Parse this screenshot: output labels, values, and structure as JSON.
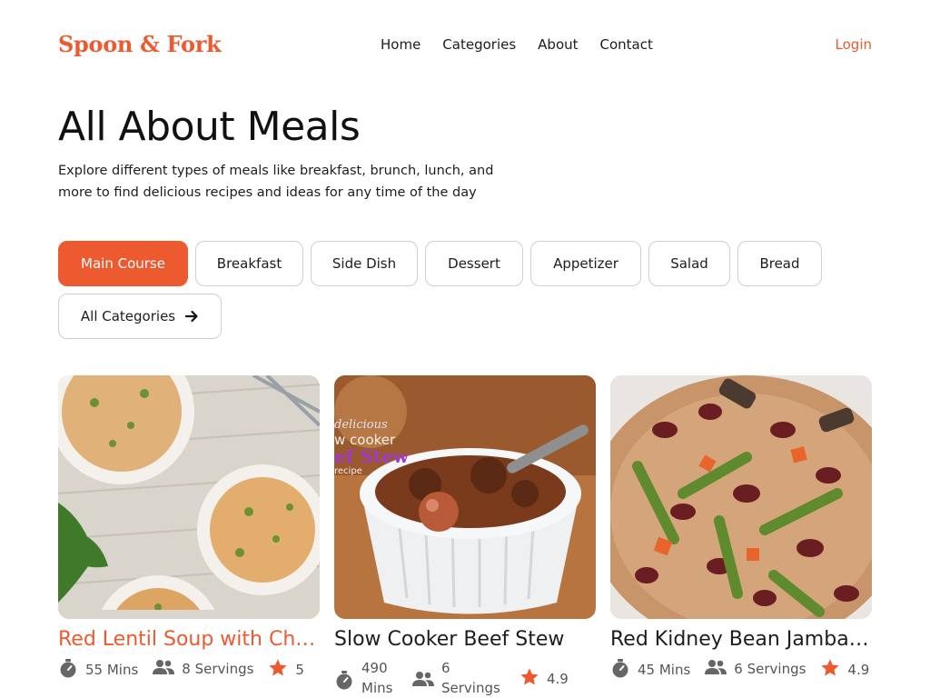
{
  "brand": {
    "name": "Spoon & Fork"
  },
  "nav": {
    "items": [
      "Home",
      "Categories",
      "About",
      "Contact"
    ],
    "login": "Login"
  },
  "hero": {
    "title": "All About Meals",
    "description": "Explore different types of meals like breakfast, brunch, lunch, and more to find delicious recipes and ideas for any time of the day"
  },
  "categories": {
    "chips": [
      "Main Course",
      "Breakfast",
      "Side Dish",
      "Dessert",
      "Appetizer",
      "Salad",
      "Bread"
    ],
    "active": "Main Course",
    "all_label": "All Categories"
  },
  "recipes": [
    {
      "title": "Red Lentil Soup with Chi…",
      "time": "55 Mins",
      "servings": "8 Servings",
      "rating": "5",
      "icons": [
        "timer-icon",
        "people-icon",
        "star-icon"
      ]
    },
    {
      "title": "Slow Cooker Beef Stew",
      "time": "490 Mins",
      "servings": "6 Servings",
      "rating": "4.9",
      "icons": [
        "timer-icon",
        "people-icon",
        "star-icon"
      ]
    },
    {
      "title": "Red Kidney Bean Jamba…",
      "time": "45 Mins",
      "servings": "6 Servings",
      "rating": "4.9",
      "icons": [
        "timer-icon",
        "people-icon",
        "star-icon"
      ]
    }
  ],
  "colors": {
    "accent": "#ee5a2f",
    "star": "#ee5a2f",
    "text": "#1d1d1d",
    "muted": "#555555",
    "border": "#cfcfcf"
  }
}
